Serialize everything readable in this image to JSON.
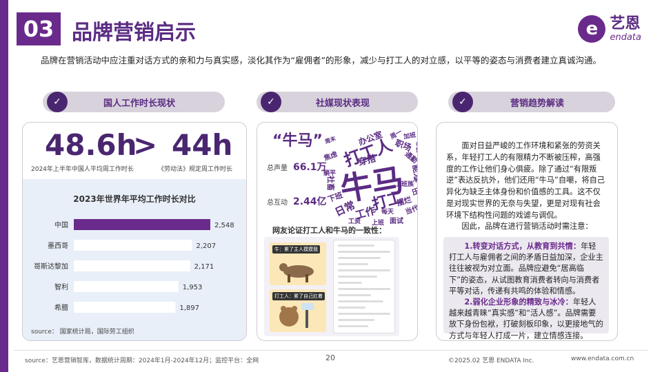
{
  "header": {
    "section_number": "03",
    "title": "品牌营销启示",
    "logo_cn": "艺恩",
    "logo_en": "endata"
  },
  "intro": "品牌在营销活动中应注重对话方式的亲和力与真实感，淡化其作为“雇佣者”的形象，减少与打工人的对立感，以平等的姿态与消费者建立真诚沟通。",
  "pills": [
    {
      "label": "国人工作时长现状",
      "icon": "check-bubble-icon"
    },
    {
      "label": "社媒现状表现",
      "icon": "check-bubble-icon"
    },
    {
      "label": "营销趋势解读",
      "icon": "check-bubble-icon"
    }
  ],
  "work_hours": {
    "value_a": "48.6h",
    "operator": ">",
    "value_b": "44h",
    "caption_a": "2024年上半年中国人平均周工作时长",
    "caption_b": "《劳动法》规定周工作时长",
    "source": "source： 国家统计局，国际劳工组织"
  },
  "chart_data": {
    "type": "bar",
    "orientation": "horizontal",
    "title": "2023年世界年平均工作时长对比",
    "categories": [
      "中国",
      "墨西哥",
      "哥斯达黎加",
      "智利",
      "希腊"
    ],
    "values": [
      2548,
      2207,
      2171,
      1953,
      1897
    ],
    "value_labels": [
      "2,548",
      "2,207",
      "2,171",
      "1,953",
      "1,897"
    ],
    "xlim": [
      0,
      2600
    ],
    "highlight_color": "#6a2a8c",
    "bar_color": "#ffffff"
  },
  "social": {
    "title": "“牛马”",
    "volume_label": "总声量",
    "volume_value": "66.1万",
    "interaction_label": "总互动",
    "interaction_value": "2.44亿",
    "cloud_words": [
      "牛马",
      "打工人",
      "打工",
      "职场",
      "日常",
      "工作",
      "下班",
      "办公室",
      "加班",
      "穿搭",
      "通勤",
      "能力",
      "社畜",
      "周一",
      "摆烂",
      "压力",
      "当代",
      "面试",
      "焦虑",
      "躺平",
      "上班族",
      "老板",
      "工资",
      "每天",
      "周末",
      "早八",
      "上班"
    ],
    "consistency_title": "网友论证打工人和牛马的一致性：",
    "meme_tags": [
      "牛：累了主人摸摸我",
      "打工人：累了自己扛着"
    ]
  },
  "trend": {
    "para1": "面对日益严峻的工作环境和紧张的劳资关系，年轻打工人的有限精力不断被压榨，高强度的工作让他们身心俱疲。除了通过“有限叛逆”表达反抗外，他们还用“牛马”自嘲，将自己异化为缺乏主体身份和价值感的工具。这不仅是对现实世界的无奈与失望，更是对现有社会环境下结构性问题的戏谑与调侃。",
    "para2": "因此，品牌在进行营销活动时需注意：",
    "point1_title": "1.转变对话方式，从教育到共情：",
    "point1_body": "年轻打工人与雇佣者之间的矛盾日益加深，企业主往往被视为对立面。品牌应避免“居高临下”的姿态，从试图教育消费者转向与消费者平等对话，传递有共鸣的体验和情感。",
    "point2_title": "2.弱化企业形象的精致与冰冷：",
    "point2_body": "年轻人越来越青睐“真实感”和“活人感”。品牌需要放下身份包袱，打破刻板印象，以更接地气的方式与年轻人打成一片，建立情感连接。"
  },
  "footer": {
    "source": "source：艺恩营销智库，数据统计周期：2024年1月-2024年12月；监控平台：全网",
    "page": "20",
    "copyright": "©2025.02  艺恩 ENDATA Inc.",
    "website": "www.endata.com.cn"
  }
}
